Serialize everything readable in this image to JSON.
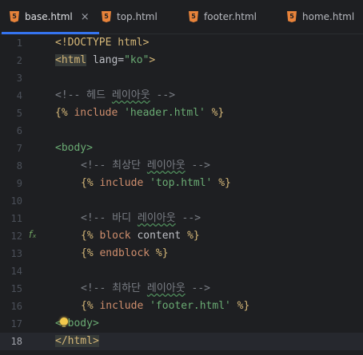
{
  "tabs": [
    {
      "label": "base.html",
      "icon": "html5-icon",
      "active": true,
      "closable": true
    },
    {
      "label": "top.html",
      "icon": "html5-icon"
    },
    {
      "label": "footer.html",
      "icon": "html5-icon"
    },
    {
      "label": "home.html",
      "icon": "html5-icon"
    }
  ],
  "gutter": {
    "line_numbers": [
      "1",
      "2",
      "3",
      "4",
      "5",
      "6",
      "7",
      "8",
      "9",
      "10",
      "11",
      "12",
      "13",
      "14",
      "15",
      "16",
      "17",
      "18"
    ],
    "current_line": "18",
    "line12_marker": "fₓ"
  },
  "code": {
    "l1": {
      "doctype": "<!DOCTYPE html>"
    },
    "l2": {
      "open": "<html",
      "attr": " lang=",
      "val": "\"ko\"",
      "close": ">"
    },
    "l4": {
      "open": "<!-- ",
      "a": "헤드 ",
      "b": "레이아웃",
      "c": " -->"
    },
    "l5": {
      "a": "{% ",
      "kw": "include",
      "sp": " ",
      "str": "'header.html'",
      "b": " %}"
    },
    "l7": {
      "text": "<body>"
    },
    "l8": {
      "open": "<!-- ",
      "a": "최상단 ",
      "b": "레이아웃",
      "c": " -->"
    },
    "l9": {
      "a": "{% ",
      "kw": "include",
      "sp": " ",
      "str": "'top.html'",
      "b": " %}"
    },
    "l11": {
      "open": "<!-- ",
      "a": "바디 ",
      "b": "레이아웃",
      "c": " -->"
    },
    "l12": {
      "a": "{% ",
      "kw": "block",
      "mid": " content",
      "b": " %}"
    },
    "l13": {
      "a": "{% ",
      "kw": "endblock",
      "b": " %}"
    },
    "l15": {
      "open": "<!-- ",
      "a": "최하단 ",
      "b": "레이아웃",
      "c": " -->"
    },
    "l16": {
      "a": "{% ",
      "kw": "include",
      "sp": " ",
      "str": "'footer.html'",
      "b": " %}"
    },
    "l17": {
      "text": "</body>"
    },
    "l18": {
      "text": "</html>"
    }
  }
}
